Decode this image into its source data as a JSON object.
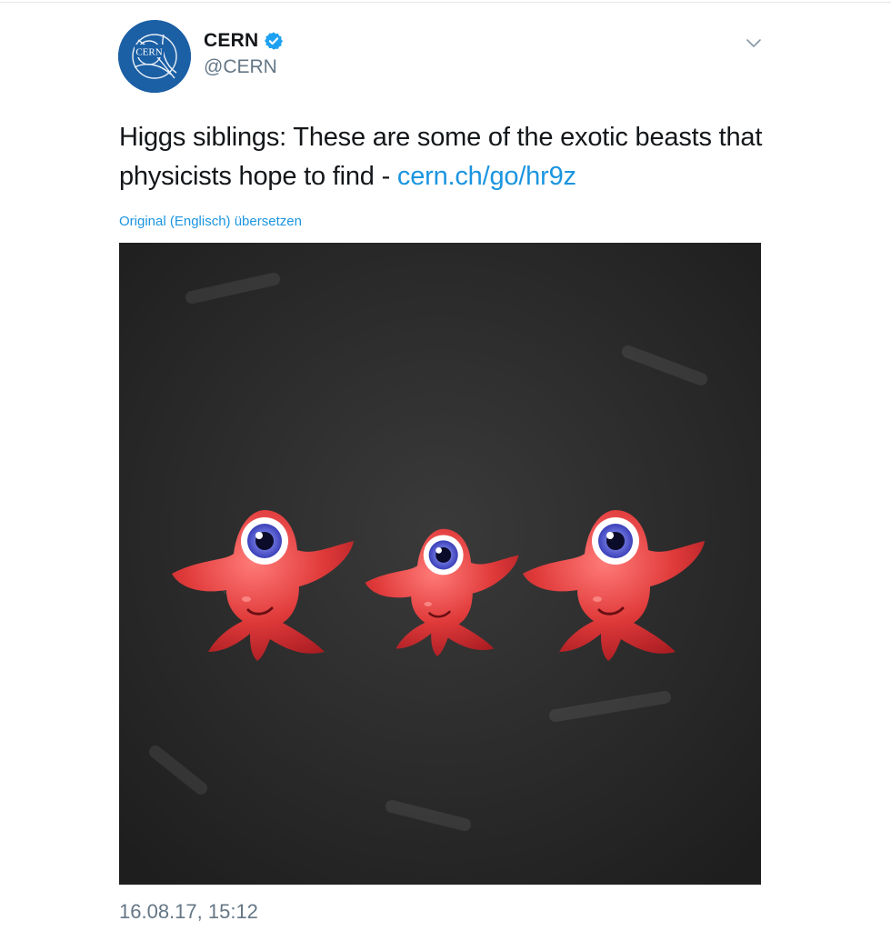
{
  "tweet": {
    "author": {
      "display_name": "CERN",
      "handle": "@CERN",
      "avatar_text": "CERN",
      "verified": true
    },
    "text_prefix": "Higgs siblings: These are some of the exotic beasts that physicists hope to find - ",
    "link_text": "cern.ch/go/hr9z",
    "translate_label": "Original (Englisch) übersetzen",
    "timestamp": "16.08.17, 15:12",
    "media": {
      "icon": "higgs-creatures-image",
      "creature_count": 3
    }
  },
  "colors": {
    "link": "#1b95e0",
    "text": "#14171a",
    "muted": "#657786",
    "avatar_bg": "#1b5fa5",
    "creature_red": "#e03a3a"
  },
  "icons": {
    "verified": "verified-badge-icon",
    "menu": "chevron-down-icon"
  }
}
